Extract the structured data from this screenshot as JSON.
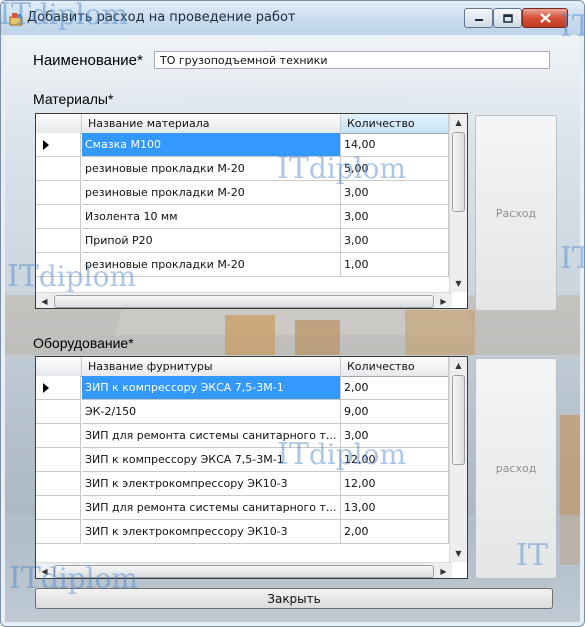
{
  "window": {
    "title": "Добавить расход на проведение работ"
  },
  "form": {
    "name_label": "Наименование*",
    "name_value": "ТО грузоподъемной техники",
    "materials_label": "Материалы*",
    "equipment_label": "Оборудование*"
  },
  "materials": {
    "columns": [
      "Название материала",
      "Количество"
    ],
    "rows": [
      {
        "name": "Смазка М100",
        "qty": "14,00"
      },
      {
        "name": "резиновые прокладки М-20",
        "qty": "5,00"
      },
      {
        "name": "резиновые прокладки М-20",
        "qty": "3,00"
      },
      {
        "name": "Изолента 10 мм",
        "qty": "3,00"
      },
      {
        "name": "Припой Р20",
        "qty": "3,00"
      },
      {
        "name": "резиновые прокладки М-20",
        "qty": "1,00"
      }
    ],
    "selected_row": 0
  },
  "equipment": {
    "columns": [
      "Название фурнитуры",
      "Количество"
    ],
    "rows": [
      {
        "name": "ЗИП к компрессору ЭКСА 7,5-3М-1",
        "qty": "2,00"
      },
      {
        "name": "ЭК-2/150",
        "qty": "9,00"
      },
      {
        "name": "ЗИП для ремонта системы санитарного т...",
        "qty": "3,00"
      },
      {
        "name": "ЗИП к компрессору ЭКСА 7,5-3М-1",
        "qty": "12,00"
      },
      {
        "name": "ЗИП к электрокомпрессору ЭК10-3",
        "qty": "12,00"
      },
      {
        "name": "ЗИП для ремонта системы санитарного т...",
        "qty": "13,00"
      },
      {
        "name": "ЗИП к электрокомпрессору ЭК10-3",
        "qty": "2,00"
      }
    ],
    "selected_row": 0
  },
  "buttons": {
    "materials_expense": "Расход",
    "equipment_expense": "расход",
    "close": "Закрыть"
  },
  "watermark": {
    "it": "IT",
    "diplom": "diplom"
  },
  "icons": {
    "app": "app-icon",
    "minimize": "minimize-icon",
    "maximize": "maximize-icon",
    "close": "close-icon",
    "row_pointer": "row-pointer-icon"
  },
  "colors": {
    "selection": "#3399ff",
    "close_button": "#c13b21",
    "watermark": "#4682c8"
  }
}
